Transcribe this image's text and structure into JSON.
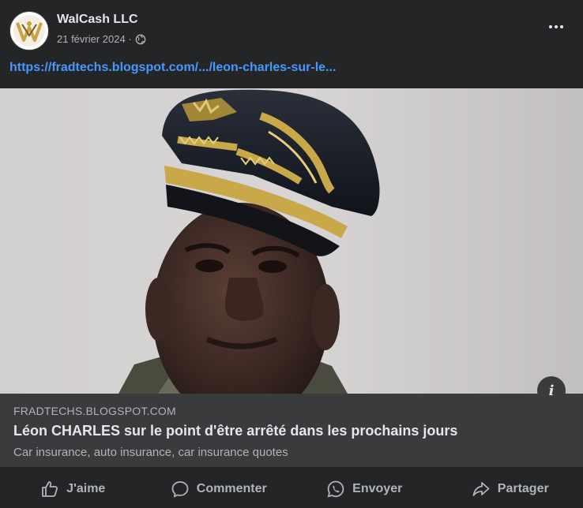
{
  "post": {
    "author": "WalCash LLC",
    "date": "21 février 2024 ·",
    "visibility_icon": "globe-icon",
    "more_icon": "more-options-icon",
    "link_url": "https://fradtechs.blogspot.com/.../leon-charles-sur-le..."
  },
  "link_preview": {
    "domain": "FRADTECHS.BLOGSPOT.COM",
    "title": "Léon CHARLES sur le point d'être arrêté dans les prochains jours",
    "description": "Car insurance, auto insurance, car insurance quotes",
    "info_label": "i"
  },
  "actions": [
    {
      "label": "J'aime",
      "icon": "like-icon"
    },
    {
      "label": "Commenter",
      "icon": "comment-icon"
    },
    {
      "label": "Envoyer",
      "icon": "whatsapp-icon"
    },
    {
      "label": "Partager",
      "icon": "share-icon"
    }
  ],
  "colors": {
    "background": "#242526",
    "link": "#4599ff",
    "preview_box": "#3a3b3c",
    "text_primary": "#e4e6eb",
    "text_secondary": "#b0b3b8"
  }
}
